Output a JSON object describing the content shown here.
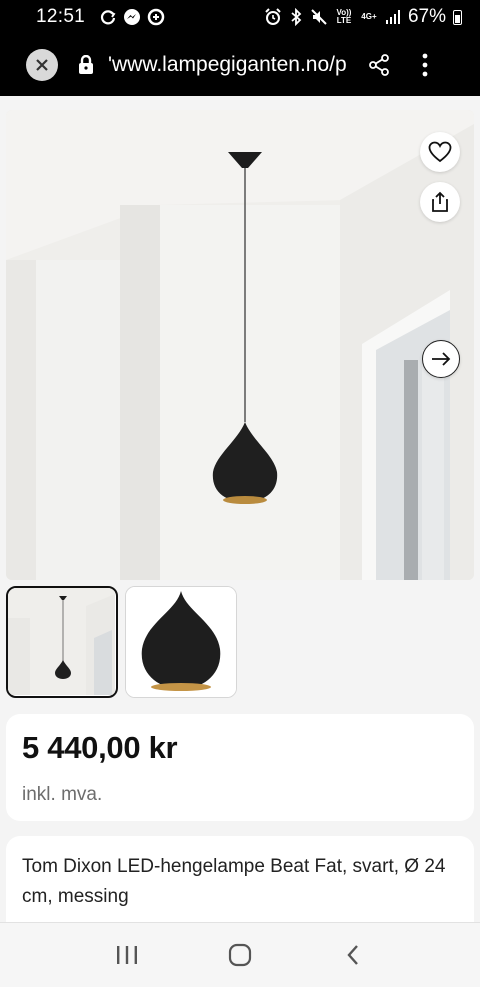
{
  "status_bar": {
    "time": "12:51",
    "network_volte": "Vo)) LTE",
    "network_4g": "4G+",
    "battery_percent": "67%"
  },
  "browser": {
    "url": "'www.lampegiganten.no/p"
  },
  "product": {
    "price": "5 440,00 kr",
    "vat_note": "inkl. mva.",
    "title": "Tom Dixon LED-hengelampe Beat Fat, svart, Ø 24 cm, messing"
  },
  "gallery": {
    "image_count": 2,
    "selected_index": 0
  },
  "icons": {
    "close": "close-icon",
    "lock": "lock-icon",
    "share": "share-icon",
    "menu": "more-vert-icon",
    "favorite": "heart-icon",
    "share_image": "share-upload-icon",
    "next": "arrow-right-icon",
    "nav_recents": "recents-icon",
    "nav_home": "home-icon",
    "nav_back": "back-icon"
  },
  "colors": {
    "status_bg": "#000000",
    "card_bg": "#ffffff",
    "page_bg": "#f4f4f4",
    "lamp_black": "#1c1c1c",
    "lamp_brass": "#b98b3e"
  }
}
